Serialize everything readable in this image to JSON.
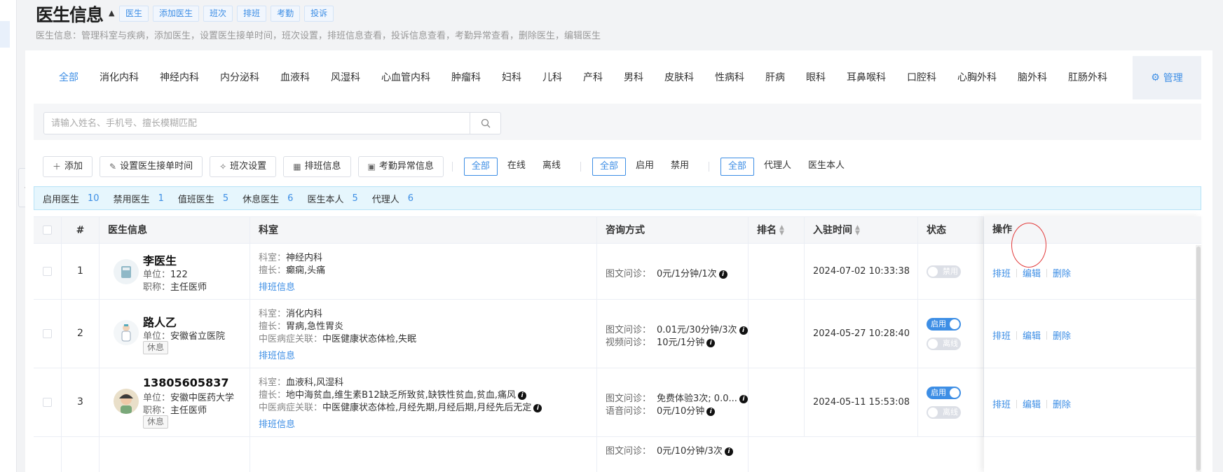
{
  "header": {
    "title": "医生信息",
    "quick_tabs": [
      "医生",
      "添加医生",
      "班次",
      "排班",
      "考勤",
      "投诉"
    ],
    "description": "医生信息：管理科室与疾病，添加医生，设置医生接单时间，班次设置，排班信息查看，投诉信息查看，考勤异常查看，删除医生，编辑医生"
  },
  "departments": [
    "全部",
    "消化内科",
    "神经内科",
    "内分泌科",
    "血液科",
    "风湿科",
    "心血管内科",
    "肿瘤科",
    "妇科",
    "儿科",
    "产科",
    "男科",
    "皮肤科",
    "性病科",
    "肝病",
    "眼科",
    "耳鼻喉科",
    "口腔科",
    "心胸外科",
    "脑外科",
    "肛肠外科"
  ],
  "manage_label": "管理",
  "search": {
    "placeholder": "请输入姓名、手机号、擅长模糊匹配"
  },
  "toolbar": {
    "add": "添加",
    "set_time": "设置医生接单时间",
    "shift_settings": "班次设置",
    "schedule_info": "排班信息",
    "attendance": "考勤异常信息",
    "online_filter": [
      "全部",
      "在线",
      "离线"
    ],
    "enable_filter": [
      "全部",
      "启用",
      "禁用"
    ],
    "role_filter": [
      "全部",
      "代理人",
      "医生本人"
    ]
  },
  "stats": [
    {
      "label": "启用医生",
      "value": "10"
    },
    {
      "label": "禁用医生",
      "value": "1"
    },
    {
      "label": "值班医生",
      "value": "5"
    },
    {
      "label": "休息医生",
      "value": "6"
    },
    {
      "label": "医生本人",
      "value": "5"
    },
    {
      "label": "代理人",
      "value": "6"
    }
  ],
  "table": {
    "columns": [
      "#",
      "医生信息",
      "科室",
      "咨询方式",
      "排名",
      "入驻时间",
      "状态",
      "操作"
    ],
    "rows": [
      {
        "index": "1",
        "name": "李医生",
        "unit": "122",
        "title": "主任医师",
        "rest": "",
        "dept": "神经内科",
        "specialty": "癫痫,头痛",
        "tcm": "",
        "schedule_link": "排班信息",
        "consult": [
          {
            "type": "图文问诊：",
            "value": "0元/1分钟/1次"
          }
        ],
        "time": "2024-07-02 10:33:38",
        "switch1": "禁用",
        "switch2": ""
      },
      {
        "index": "2",
        "name": "路人乙",
        "unit": "安徽省立医院",
        "title": "",
        "rest": "休息",
        "dept": "消化内科",
        "specialty": "胃病,急性胃炎",
        "tcm": "中医健康状态体检,失眠",
        "schedule_link": "排班信息",
        "consult": [
          {
            "type": "图文问诊：",
            "value": "0.01元/30分钟/3次"
          },
          {
            "type": "视频问诊：",
            "value": "10元/1分钟"
          }
        ],
        "time": "2024-05-27 10:28:40",
        "switch1": "启用",
        "switch2": "离线"
      },
      {
        "index": "3",
        "name": "13805605837",
        "unit": "安徽中医药大学",
        "title": "主任医师",
        "rest": "休息",
        "dept": "血液科,风湿科",
        "specialty": "地中海贫血,维生素B12缺乏所致贫,缺铁性贫血,贫血,痛风",
        "tcm": "中医健康状态体检,月经先期,月经后期,月经先后无定",
        "schedule_link": "排班信息",
        "consult": [
          {
            "type": "图文问诊：",
            "value": "免费体验3次; 0.0..."
          },
          {
            "type": "语音问诊：",
            "value": "0元/10分钟"
          }
        ],
        "time": "2024-05-11 15:53:08",
        "switch1": "启用",
        "switch2": "离线"
      },
      {
        "index": "",
        "partial_consult": "0元/10分钟/3次"
      }
    ]
  },
  "labels": {
    "dept": "科室：",
    "specialty": "擅长：",
    "tcm": "中医病症关联：",
    "unit": "单位：",
    "title": "职称：",
    "op_schedule": "排班",
    "op_edit": "编辑",
    "op_delete": "删除",
    "consult_partial_type": "图文问诊："
  }
}
